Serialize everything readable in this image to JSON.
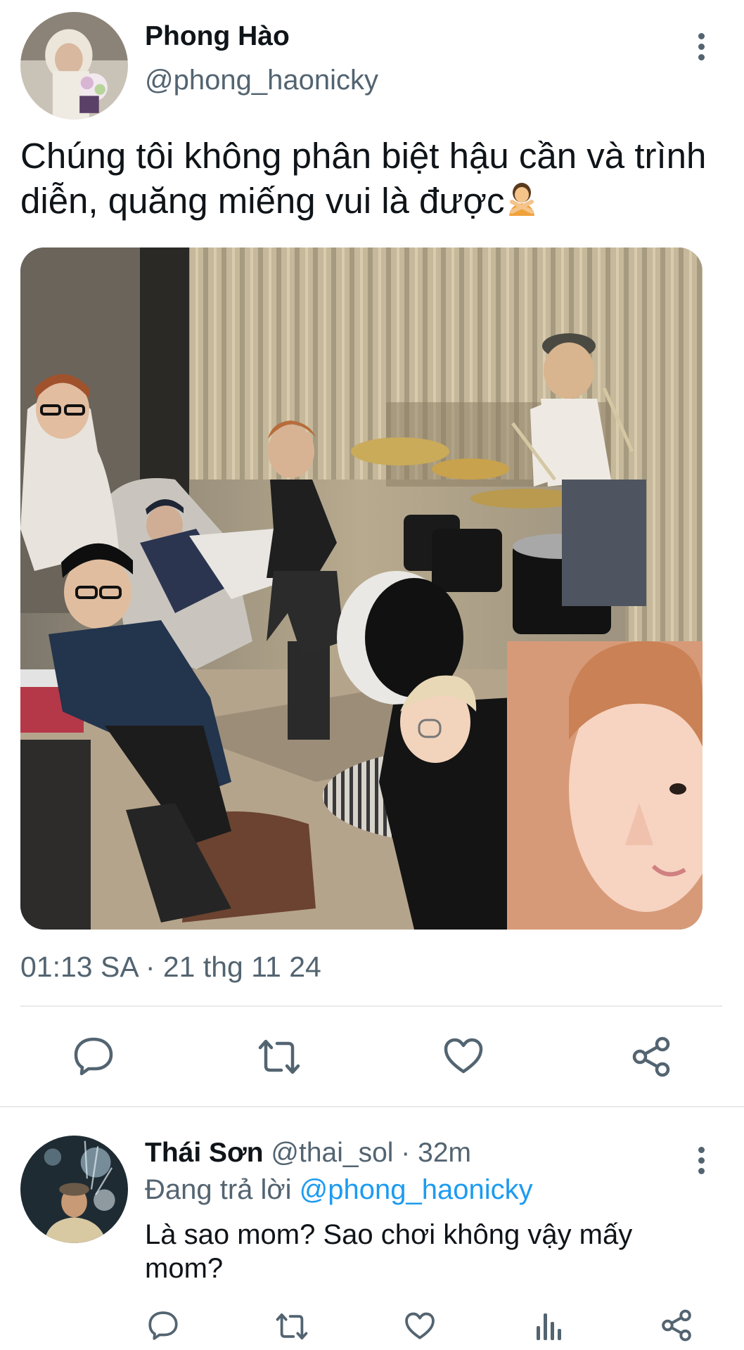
{
  "tweet": {
    "author_name": "Phong Hào",
    "author_handle": "@phong_haonicky",
    "text": "Chúng tôi không phân biệt hậu cần và trình diễn, quăng miếng vui là được",
    "emoji": "person-gesturing-no-emoji",
    "timestamp": "01:13 SA · 21 thg 11 24",
    "actions": [
      "reply-icon",
      "retweet-icon",
      "like-icon",
      "share-icon"
    ]
  },
  "reply": {
    "author_name": "Thái Sơn",
    "author_handle": "@thai_sol",
    "separator": "·",
    "time": "32m",
    "replying_prefix": "Đang trả lời",
    "replying_handle": "@phong_haonicky",
    "text": "Là sao mom? Sao chơi không vậy mấy mom?",
    "actions": [
      "reply-icon",
      "retweet-icon",
      "like-icon",
      "views-icon",
      "share-icon"
    ]
  },
  "colors": {
    "text_primary": "#0f1419",
    "text_secondary": "#536471",
    "link": "#1d9bf0",
    "divider": "#e7e9ea"
  }
}
